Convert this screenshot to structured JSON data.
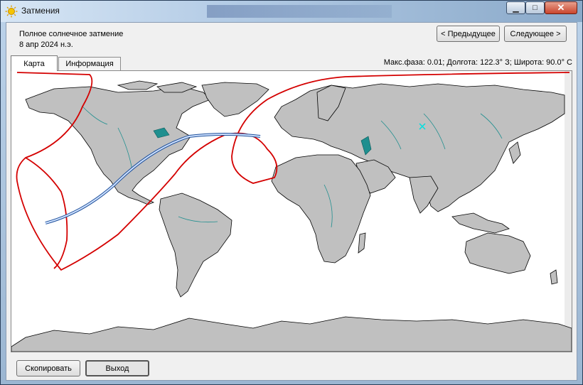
{
  "window": {
    "title": "Затмения",
    "icon": "sun-icon",
    "controls": {
      "minimize": "minimize-icon",
      "maximize": "maximize-icon",
      "close": "close-icon"
    }
  },
  "eclipse": {
    "type": "Полное солнечное затмение",
    "date": "8 апр 2024 н.э."
  },
  "nav": {
    "prev_label": "< Предыдущее",
    "next_label": "Следующее >"
  },
  "tabs": [
    {
      "label": "Карта",
      "active": true
    },
    {
      "label": "Информация",
      "active": false
    }
  ],
  "status": "Макс.фаза: 0.01;  Долгота: 122.3° З;  Широта: 90.0° С",
  "footer": {
    "copy_label": "Скопировать",
    "exit_label": "Выход"
  },
  "colors": {
    "land": "#c0c0c0",
    "coast": "#000000",
    "rivers": "#1f8f8f",
    "penumbra": "#d40000",
    "totality_path": "#6f9fd8"
  }
}
